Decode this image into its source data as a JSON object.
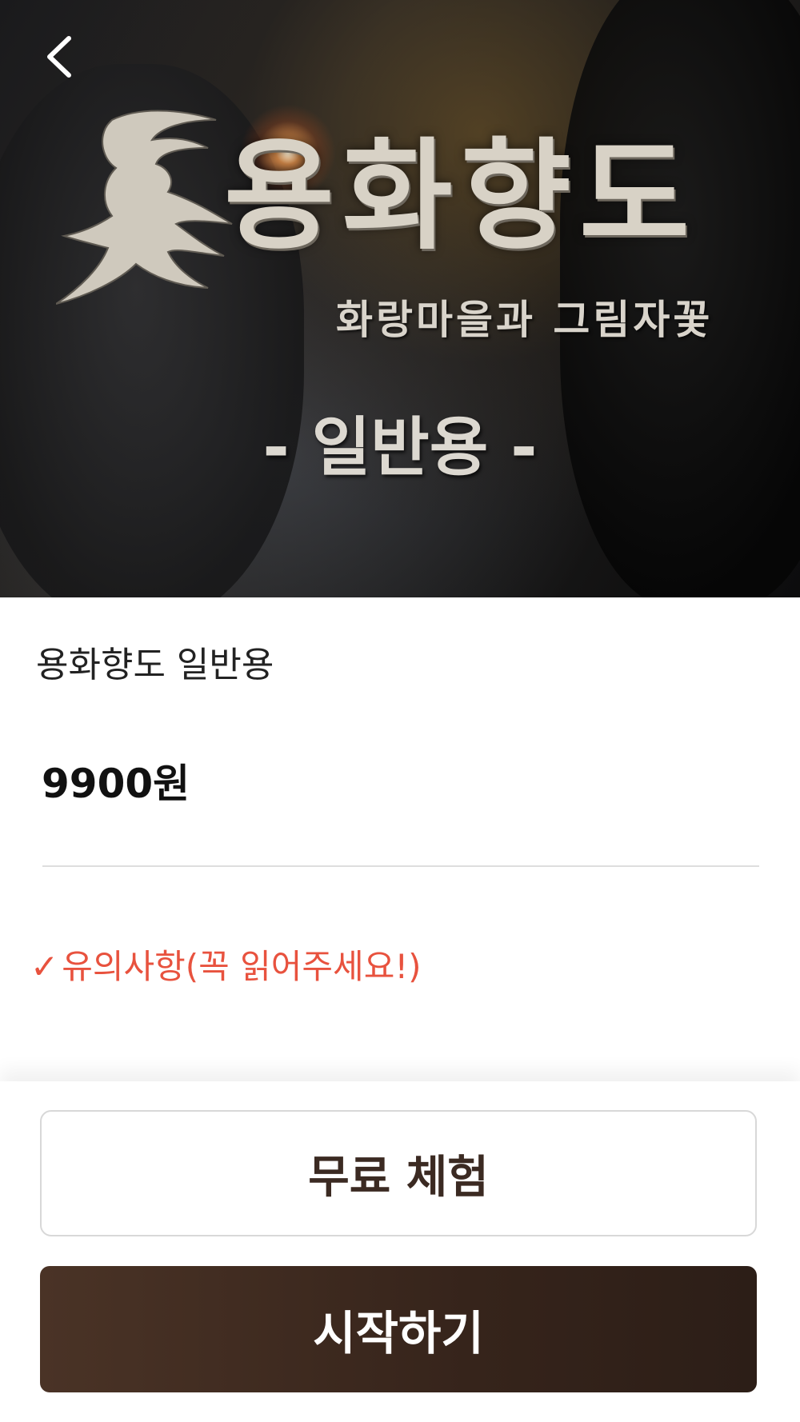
{
  "hero": {
    "title": "용화향도",
    "subtitle": "화랑마을과 그림자꽃",
    "edition": "- 일반용 -"
  },
  "product": {
    "name": "용화향도 일반용",
    "price": "9900원"
  },
  "notice": {
    "check_icon": "check-icon",
    "text": "유의사항(꼭 읽어주세요!)",
    "color": "#e8523e"
  },
  "actions": {
    "trial_label": "무료 체험",
    "start_label": "시작하기"
  },
  "colors": {
    "primary_button": "#3b2a22",
    "accent_red": "#e8523e"
  }
}
